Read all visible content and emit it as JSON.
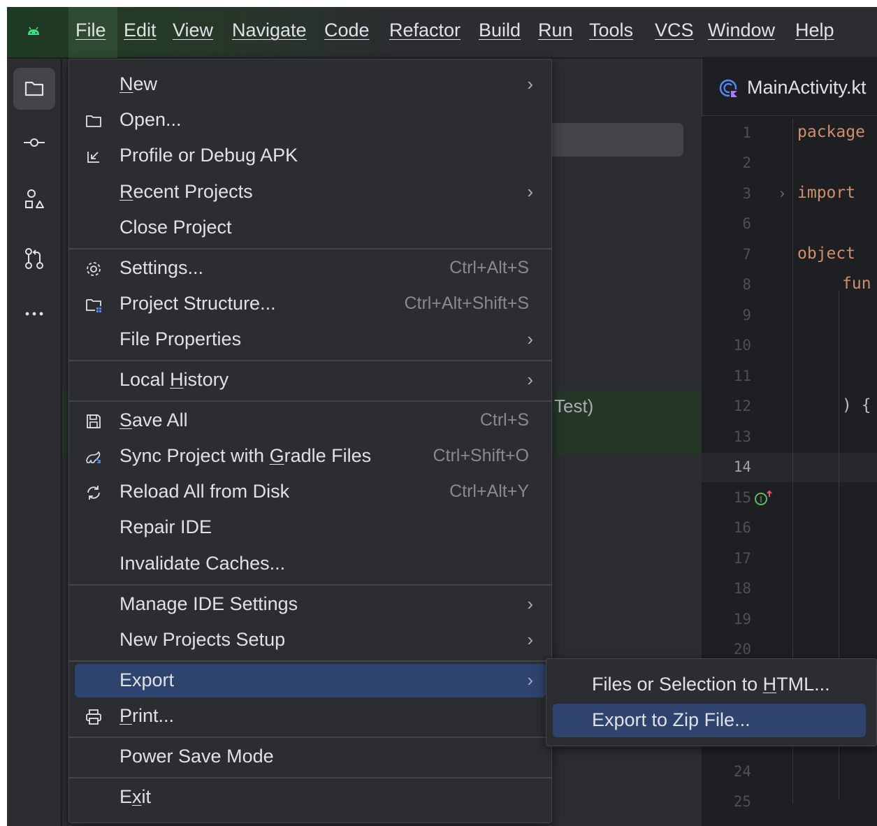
{
  "menubar": {
    "items": [
      "File",
      "Edit",
      "View",
      "Navigate",
      "Code",
      "Refactor",
      "Build",
      "Run",
      "Tools",
      "VCS",
      "Window",
      "Help"
    ]
  },
  "stripe": {
    "icons": [
      "project-icon",
      "commit-icon",
      "resource-manager-icon",
      "pull-requests-icon",
      "more-icon"
    ]
  },
  "editor": {
    "tab_label": "MainActivity.kt",
    "line_numbers": [
      "1",
      "2",
      "3",
      "6",
      "7",
      "8",
      "9",
      "10",
      "11",
      "12",
      "13",
      "14",
      "15",
      "16",
      "17",
      "18",
      "19",
      "20",
      "24",
      "25"
    ],
    "current_line": "14",
    "code": {
      "line1": "package",
      "line3": "import",
      "line7": "object",
      "line8": "fun",
      "line12": ") {"
    }
  },
  "project_panel": {
    "visible_text": "Test)"
  },
  "file_menu": {
    "new": "New",
    "open": "Open...",
    "profile_debug": "Profile or Debug APK",
    "recent_projects": "Recent Projects",
    "close_project": "Close Project",
    "settings": "Settings...",
    "settings_shortcut": "Ctrl+Alt+S",
    "project_structure": "Project Structure...",
    "project_structure_shortcut": "Ctrl+Alt+Shift+S",
    "file_properties": "File Properties",
    "local_history": "Local History",
    "save_all": "Save All",
    "save_all_shortcut": "Ctrl+S",
    "sync_gradle": "Sync Project with Gradle Files",
    "sync_gradle_shortcut": "Ctrl+Shift+O",
    "reload_disk": "Reload All from Disk",
    "reload_disk_shortcut": "Ctrl+Alt+Y",
    "repair_ide": "Repair IDE",
    "invalidate_caches": "Invalidate Caches...",
    "manage_ide_settings": "Manage IDE Settings",
    "new_projects_setup": "New Projects Setup",
    "export": "Export",
    "print": "Print...",
    "power_save": "Power Save Mode",
    "exit": "Exit"
  },
  "export_submenu": {
    "files_to_html": "Files or Selection to HTML...",
    "export_zip": "Export to Zip File..."
  },
  "colors": {
    "menu_bg": "#2b2d30",
    "highlight": "#2e436e",
    "editor_bg": "#1e1f22",
    "keyword": "#cf8e6d"
  }
}
